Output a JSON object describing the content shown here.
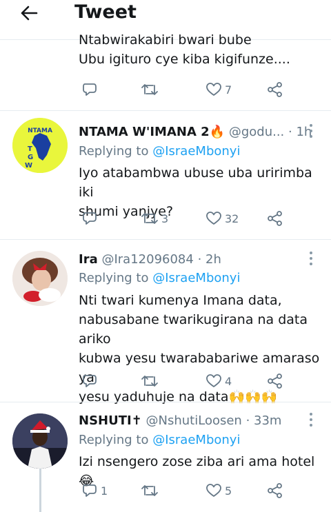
{
  "header": {
    "title": "Tweet",
    "back_icon": "arrow-left-icon"
  },
  "top_tweet": {
    "lines": [
      "Ntabwirakabiri bwari bube",
      "Ubu igituro cye kiba kigifunze...."
    ],
    "likes": "7"
  },
  "replies": [
    {
      "name": "NTAMA W'IMANA 2",
      "name_emoji": "🔥",
      "handle": "@godu...",
      "time": "1h",
      "replying_label": "Replying to",
      "mention": "@IsraeMbonyi",
      "text_lines": [
        "Iyo atabambwa ubuse uba uririmba iki",
        "shumi yanjye?"
      ],
      "replies": "",
      "retweets": "3",
      "likes": "32",
      "avatar_text": "NTAMA T G W"
    },
    {
      "name": "Ira",
      "handle": "@Ira12096084",
      "time": "2h",
      "replying_label": "Replying to",
      "mention": "@IsraeMbonyi",
      "text_lines": [
        "Nti twari kumenya Imana data,",
        "nabusabane twarikugirana na data ariko",
        "kubwa yesu twarababariwe amaraso ya",
        "yesu yaduhuje na data"
      ],
      "text_emoji": "🙌🙌🙌",
      "replies": "",
      "retweets": "",
      "likes": "4"
    },
    {
      "name": "NSHUTI✝",
      "handle": "@NshutiLoosen",
      "time": "33m",
      "replying_label": "Replying to",
      "mention": "@IsraeMbonyi",
      "text_lines": [
        "Izi nsengero zose ziba ari ama hotel"
      ],
      "text_emoji": "😂",
      "replies": "1",
      "retweets": "",
      "likes": "5"
    }
  ],
  "colors": {
    "accent": "#1da1f2",
    "muted": "#657786",
    "divider": "#e6ecf0",
    "text": "#14171a"
  }
}
